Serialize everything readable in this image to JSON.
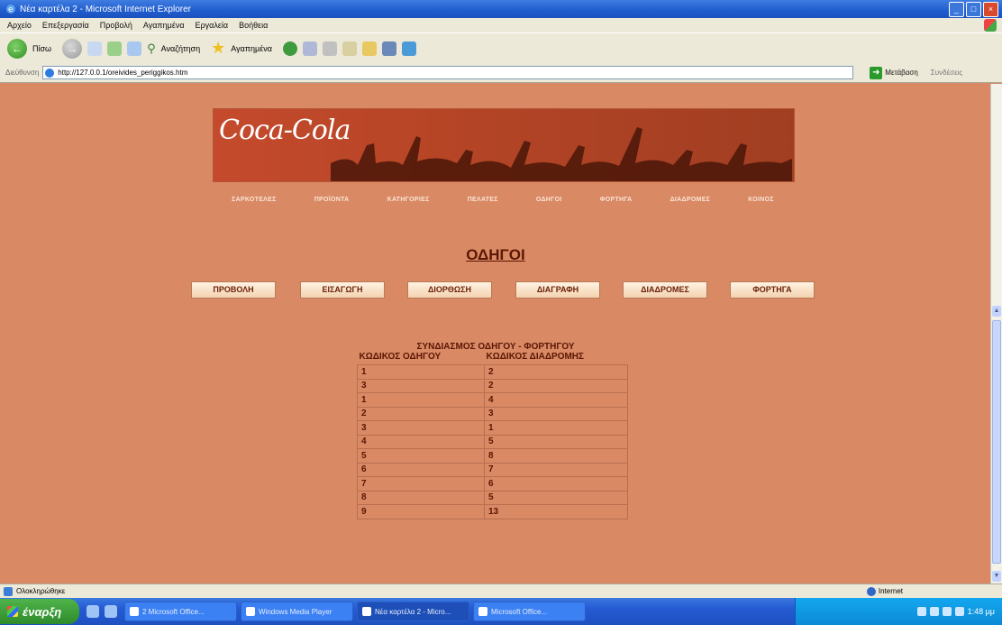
{
  "window": {
    "title": "Νέα καρτέλα 2 - Microsoft Internet Explorer",
    "controls": [
      "_",
      "□",
      "×"
    ]
  },
  "menu": [
    "Αρχείο",
    "Επεξεργασία",
    "Προβολή",
    "Αγαπημένα",
    "Εργαλεία",
    "Βοήθεια"
  ],
  "toolbar": {
    "back_label": "Πίσω",
    "search_label": "Αναζήτηση",
    "favorites_label": "Αγαπημένα"
  },
  "address": {
    "label": "Διεύθυνση",
    "url": "http://127.0.0.1/oreivides_periggikos.htm",
    "go_label": "Μετάβαση",
    "links_label": "Συνδέσεις"
  },
  "site": {
    "logo": "Coca-Cola",
    "nav": [
      "ΣΑΡΚΟΤΕΛΕΣ",
      "ΠΡΟΪΟΝΤΑ",
      "ΚΑΤΗΓΟΡΙΕΣ",
      "ΠΕΛΑΤΕΣ",
      "ΟΔΗΓΟΙ",
      "ΦΟΡΤΗΓΑ",
      "ΔΙΑΔΡΟΜΕΣ",
      "ΚΟΙΝΟΣ"
    ]
  },
  "page": {
    "heading": "ΟΔΗΓΟΙ",
    "actions": [
      "ΠΡΟΒΟΛΗ",
      "ΕΙΣΑΓΩΓΗ",
      "ΔΙΟΡΘΩΣΗ",
      "ΔΙΑΓΡΑΦΗ",
      "ΔΙΑΔΡΟΜΕΣ",
      "ΦΟΡΤΗΓΑ"
    ],
    "subheading": "ΣΥΝΔΙΑΣΜΟΣ ΟΔΗΓΟΥ - ΦΟΡΤΗΓΟΥ",
    "table": {
      "headers": [
        "ΚΩΔΙΚΟΣ ΟΔΗΓΟΥ",
        "ΚΩΔΙΚΟΣ ΔΙΑΔΡΟΜΗΣ"
      ],
      "rows": [
        [
          "1",
          "2"
        ],
        [
          "3",
          "2"
        ],
        [
          "1",
          "4"
        ],
        [
          "2",
          "3"
        ],
        [
          "3",
          "1"
        ],
        [
          "4",
          "5"
        ],
        [
          "5",
          "8"
        ],
        [
          "6",
          "7"
        ],
        [
          "7",
          "6"
        ],
        [
          "8",
          "5"
        ],
        [
          "9",
          "13"
        ]
      ]
    }
  },
  "status": {
    "text": "Ολοκληρώθηκε",
    "zone": "Internet"
  },
  "taskbar": {
    "start_label": "έναρξη",
    "tasks": [
      "2 Microsoft Office...",
      "Windows Media Player",
      "Νέα καρτέλα 2 - Micro...",
      "Microsoft Office..."
    ],
    "clock": "1:48 μμ"
  },
  "colors": {
    "page_bg": "#d98964",
    "heading": "#5a1704",
    "banner": "#b94627"
  }
}
